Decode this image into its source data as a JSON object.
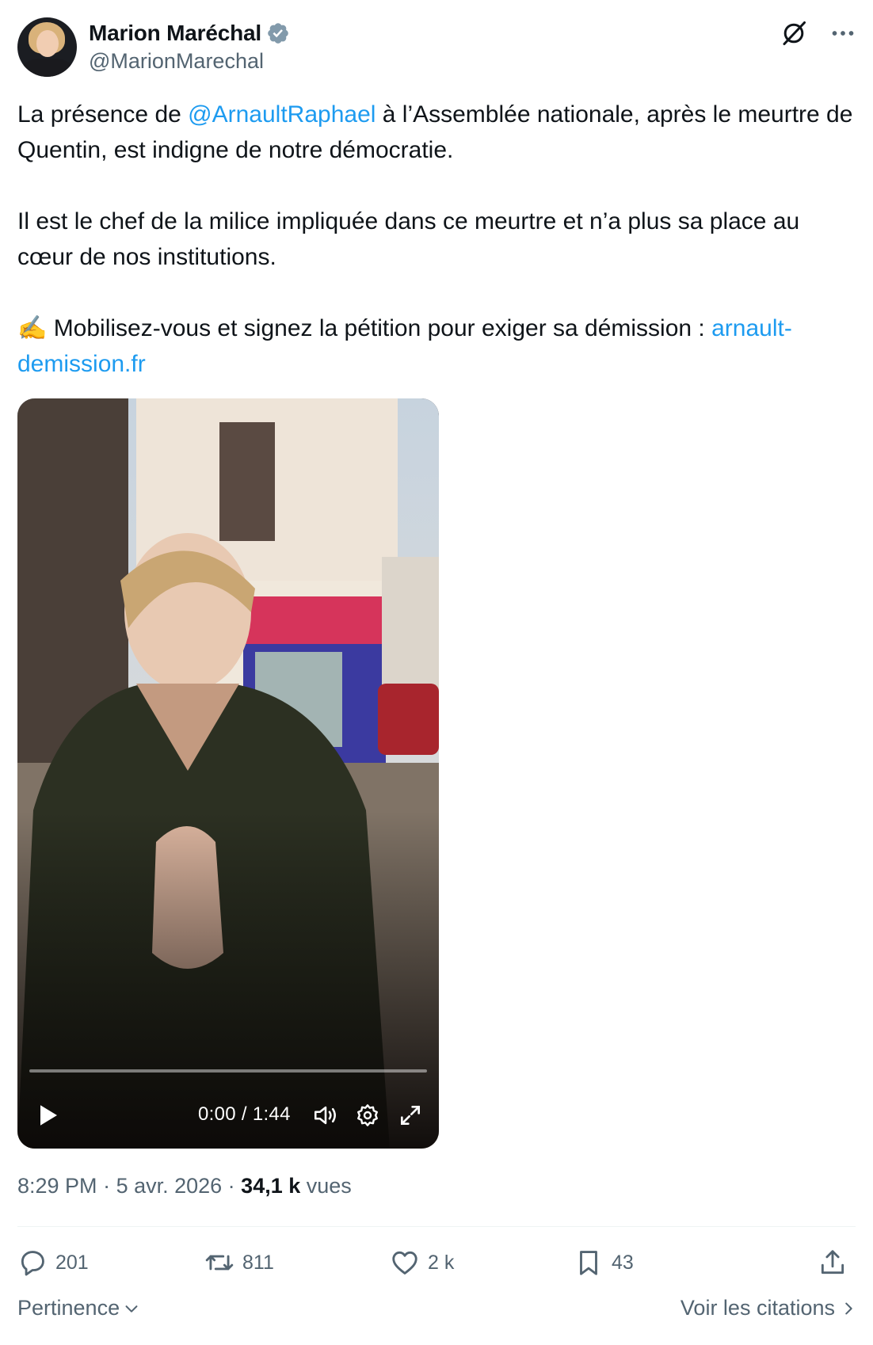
{
  "author": {
    "display_name": "Marion Maréchal",
    "handle": "@MarionMarechal",
    "verified": true,
    "verified_color": "#829aab"
  },
  "tweet": {
    "line1_pre": "La présence de ",
    "mention": "@ArnaultRaphael",
    "line1_post": " à l’Assemblée nationale, après le meurtre de Quentin, est indigne de notre démocratie.",
    "paragraph2": "Il est le chef de la milice impliquée dans ce meurtre et n’a plus sa place au cœur de nos institutions.",
    "paragraph3_emoji": "✍️",
    "paragraph3": " Mobilisez-vous et signez la pétition pour exiger sa démission : ",
    "url": "arnault-demission.fr",
    "link_color": "#1d9bf0"
  },
  "video": {
    "time": "0:00 / 1:44",
    "progress": 0
  },
  "meta": {
    "time": "8:29 PM",
    "separator": " · ",
    "date": "5 avr. 2026",
    "views_count": "34,1 k",
    "views_label": "vues"
  },
  "actions": {
    "replies": "201",
    "reposts": "811",
    "likes": "2 k",
    "bookmarks": "43"
  },
  "footer": {
    "sort_label": "Pertinence",
    "quotes_label": "Voir les citations"
  },
  "icons": [
    "verified-badge-icon",
    "grok-icon",
    "more-icon",
    "play-icon",
    "volume-icon",
    "settings-icon",
    "fullscreen-icon",
    "reply-icon",
    "repost-icon",
    "like-icon",
    "bookmark-icon",
    "share-icon",
    "chevron-down-icon",
    "chevron-right-icon"
  ]
}
